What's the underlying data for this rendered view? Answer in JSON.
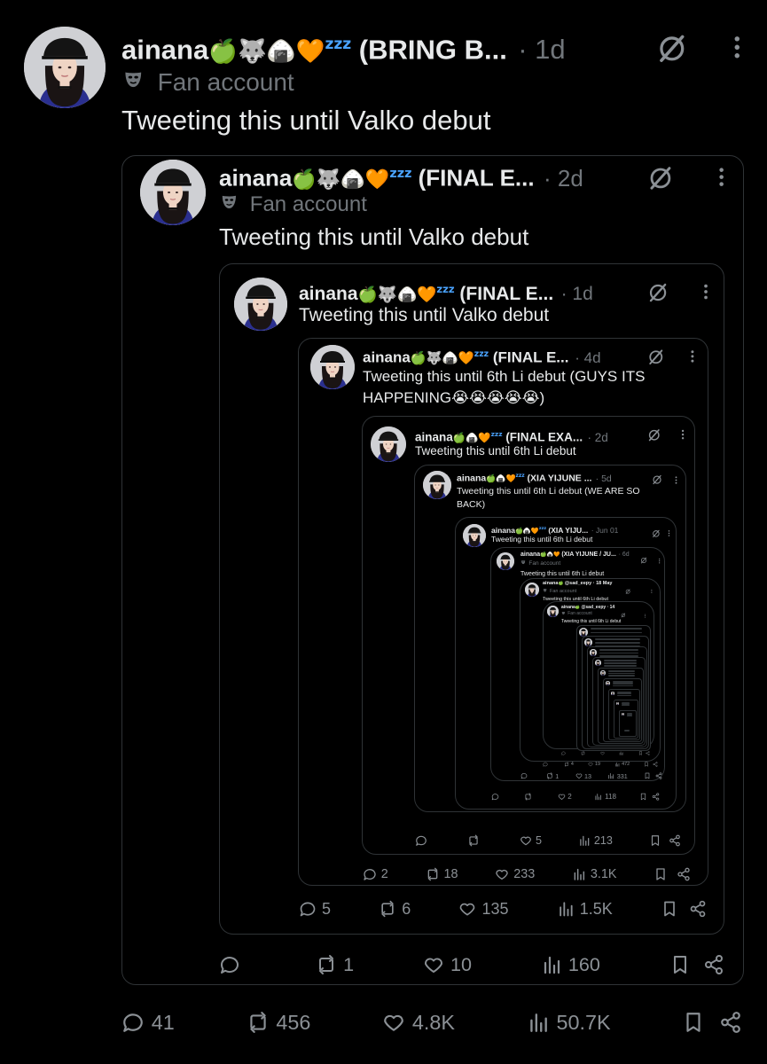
{
  "colors": {
    "background": "#000000",
    "text": "#e7e9ea",
    "muted": "#71767b",
    "border": "#2f3336",
    "accent": "#1d9bf0"
  },
  "tweets": [
    {
      "name": "ainana",
      "emoji": "🍏🐺🍙🧡",
      "zz": "zzz",
      "display_suffix": " (BRING B...",
      "time": "· 1d",
      "badge": "Fan account",
      "text": "Tweeting this until Valko debut",
      "replies": "41",
      "reposts": "456",
      "likes": "4.8K",
      "views": "50.7K"
    },
    {
      "name": "ainana",
      "emoji": "🍏🐺🍙🧡",
      "zz": "zzz",
      "display_suffix": " (FINAL E...",
      "time": "· 2d",
      "badge": "Fan account",
      "text": "Tweeting this until Valko debut",
      "replies": "",
      "reposts": "1",
      "likes": "10",
      "views": "160"
    },
    {
      "name": "ainana",
      "emoji": "🍏🐺🍙🧡",
      "zz": "zzz",
      "display_suffix": " (FINAL E...",
      "time": "· 1d",
      "text": "Tweeting this until Valko debut",
      "replies": "5",
      "reposts": "6",
      "likes": "135",
      "views": "1.5K"
    },
    {
      "name": "ainana",
      "emoji": "🍏🐺🍙🧡",
      "zz": "zzz",
      "display_suffix": " (FINAL E...",
      "time": "· 4d",
      "text": "Tweeting this until 6th Li debut (GUYS ITS HAPPENING😭😭😭😭😭)",
      "replies": "2",
      "reposts": "18",
      "likes": "233",
      "views": "3.1K"
    },
    {
      "name": "ainana",
      "emoji": "🍏🍙🧡",
      "zz": "zzz",
      "display_suffix": " (FINAL EXA...",
      "time": "· 2d",
      "text": "Tweeting this until 6th Li debut",
      "replies": "",
      "reposts": "",
      "likes": "5",
      "views": "213"
    },
    {
      "name": "ainana",
      "emoji": "🍏🍙🧡",
      "zz": "zzz",
      "display_suffix": " (XIA YIJUNE ...",
      "time": "· 5d",
      "text": "Tweeting this until 6th Li debut (WE ARE SO BACK)",
      "replies": "",
      "reposts": "1",
      "likes": "2",
      "views": "97"
    },
    {
      "name": "ainana",
      "emoji": "🍏🍙🧡",
      "zz": "zzz",
      "display_suffix": " (XIA YIJU...",
      "time": "· Jun 01",
      "text": "Tweeting this until 6th Li debut",
      "replies": "",
      "reposts": "",
      "likes": "2",
      "views": "118"
    },
    {
      "name": "ainana",
      "emoji": "🍏🍙🧡",
      "zz": "",
      "display_suffix": " (XIA YIJUNE / JU...",
      "time": "· 6d",
      "badge": "Fan account",
      "text": "Tweeting this until 6th Li debut",
      "replies": "",
      "reposts": "1",
      "likes": "13",
      "views": "331"
    },
    {
      "name": "ainana",
      "emoji": "🍏",
      "zz": "",
      "display_suffix": " @sad_eepy · 18 May",
      "time": "",
      "badge": "Fan account",
      "text": "Tweeting this until 6th Li debut",
      "replies": "",
      "reposts": "4",
      "likes": "19",
      "views": "472"
    },
    {
      "name": "ainana",
      "emoji": "🍏",
      "zz": "",
      "display_suffix": " @sad_eepy · 14",
      "time": "",
      "badge": "Fan account",
      "text": "Tweeting this until 6th Li debut",
      "replies": "",
      "reposts": "",
      "likes": "",
      "views": ""
    }
  ]
}
